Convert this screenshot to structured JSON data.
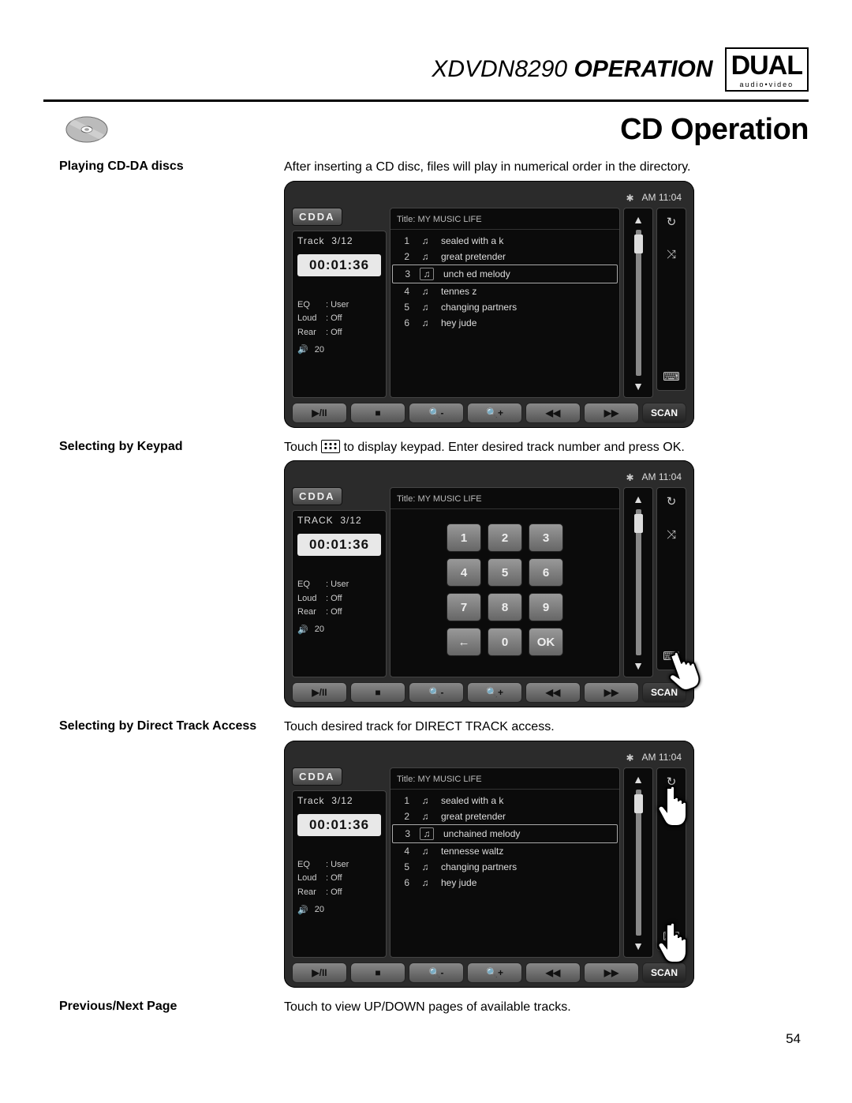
{
  "header": {
    "model": "XDVDN8290",
    "operation": "OPERATION",
    "brand_top": "DUAL",
    "brand_bottom": "audio•video"
  },
  "section_title": "CD Operation",
  "rows": {
    "r1": {
      "label": "Playing CD-DA discs",
      "body": "After inserting a CD disc, files will play in numerical order in the directory."
    },
    "r2": {
      "label": "Selecting by Keypad",
      "body_pre": "Touch ",
      "body_post": " to display keypad. Enter desired track number and press OK."
    },
    "r3": {
      "label": "Selecting by Direct Track Access",
      "body": "Touch desired track for DIRECT TRACK access."
    },
    "r4": {
      "label": "Previous/Next Page",
      "body": "Touch to view UP/DOWN pages of available tracks."
    }
  },
  "device": {
    "mode": "CDDA",
    "clock": "AM 11:04",
    "track_label": "Track",
    "track_value": "3/12",
    "track_label_upper": "TRACK",
    "time": "00:01:36",
    "title_label": "Title:",
    "title_value": "MY  MUSIC LIFE",
    "eq_label": "EQ",
    "eq_value": "User",
    "loud_label": "Loud",
    "loud_value": "Off",
    "rear_label": "Rear",
    "rear_value": "Off",
    "vol_value": "20",
    "tracks": [
      {
        "n": "1",
        "name": "sealed with a k"
      },
      {
        "n": "2",
        "name": "great pretender"
      },
      {
        "n": "3",
        "name": "unchained melody"
      },
      {
        "n": "4",
        "name": "tennesse waltz"
      },
      {
        "n": "5",
        "name": "changing partners"
      },
      {
        "n": "6",
        "name": "hey jude"
      }
    ],
    "tracks_masked": [
      {
        "n": "1",
        "name": "sealed with a k"
      },
      {
        "n": "2",
        "name": "great pretender"
      },
      {
        "n": "3",
        "name": "unch     ed melody"
      },
      {
        "n": "4",
        "name": "tennes        z"
      },
      {
        "n": "5",
        "name": "changing partners"
      },
      {
        "n": "6",
        "name": "hey jude"
      }
    ],
    "keypad": [
      "1",
      "2",
      "3",
      "4",
      "5",
      "6",
      "7",
      "8",
      "9",
      "←",
      "0",
      "OK"
    ],
    "controls": {
      "play": "▶/II",
      "stop": "■",
      "zminus": "🔍-",
      "zplus": "🔍+",
      "rew": "◀◀",
      "ff": "▶▶",
      "scan": "SCAN"
    }
  },
  "page_number": "54"
}
